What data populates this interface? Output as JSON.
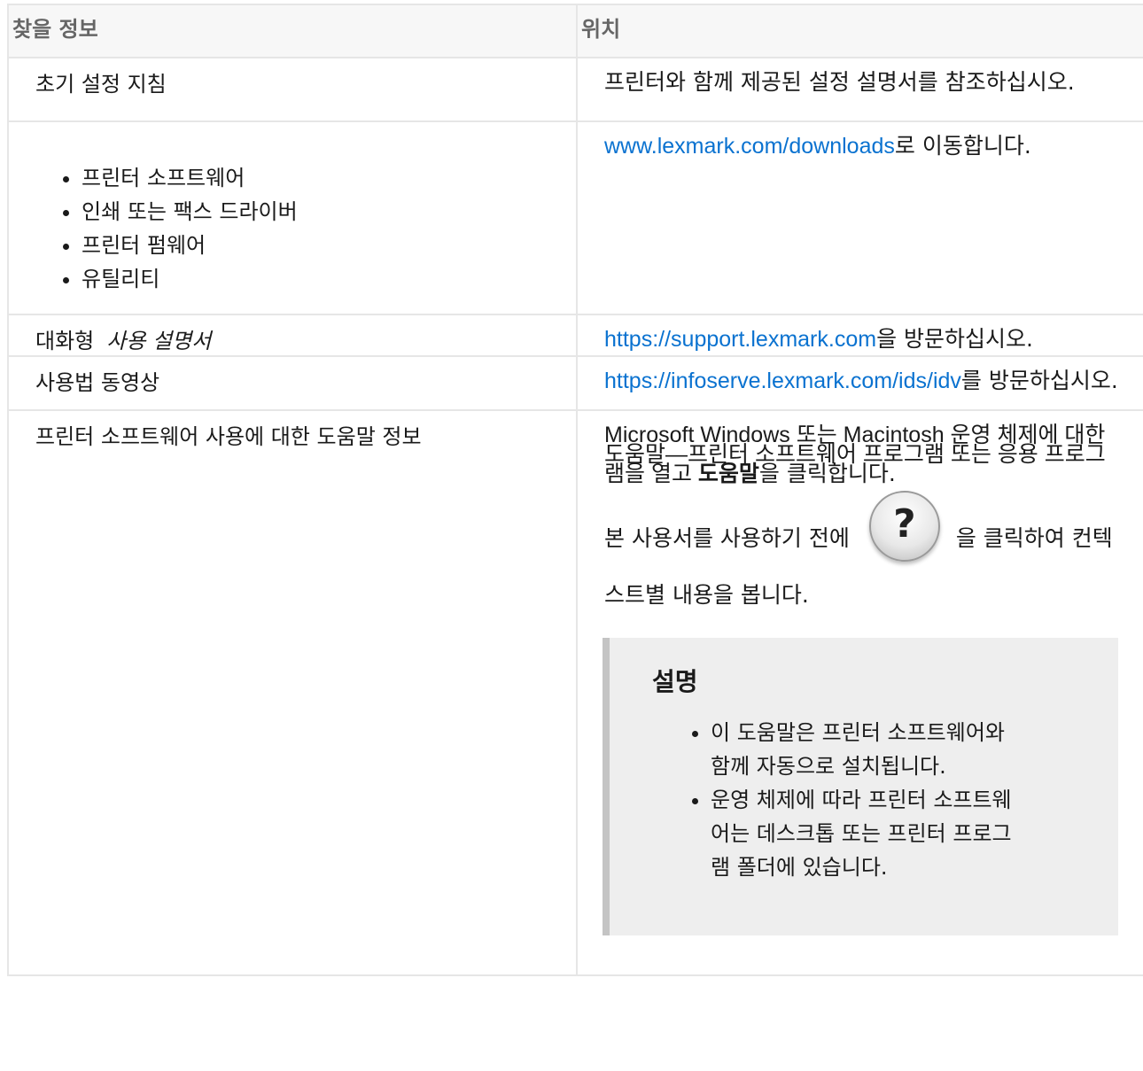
{
  "table": {
    "headers": {
      "info": "찾을 정보",
      "location": "위치"
    },
    "rows": [
      {
        "info": "초기 설정 지침",
        "location": "프린터와 함께 제공된 설정 설명서를 참조하십시오."
      },
      {
        "info_items": [
          "프린터 소프트웨어",
          "인쇄 또는 팩스 드라이버",
          "프린터 펌웨어",
          "유틸리티"
        ],
        "location_link": "www.lexmark.com/downloads",
        "location_suffix": "로 이동합니다."
      },
      {
        "info_prefix": "대화형",
        "info_emphasis": "사용 설명서",
        "location_link": "https://support.lexmark.com",
        "location_suffix": "을 방문하십시오."
      },
      {
        "info": "사용법 동영상",
        "location_link": "https://infoserve.lexmark.com/ids/idv",
        "location_suffix": "를 방문하십시오."
      },
      {
        "info": "프린터 소프트웨어 사용에 대한 도움말 정보",
        "location_text": "Microsoft Windows 또는 Macintosh 운영 체제에 대한 도움말—프린터 소프트웨어 프로그램 또는 응용 프로그램을 열고 ",
        "location_bold": "도움말",
        "location_text_end": "을 클릭합니다.",
        "help_before": "본 사용서를 사용하기 전에",
        "help_icon": "question-mark-icon",
        "help_icon_glyph": "?",
        "help_after": "을 클릭하여 컨텍스트별 내용을 봅니다.",
        "note": {
          "title": "설명",
          "items": [
            "이 도움말은 프린터 소프트웨어와 함께 자동으로 설치됩니다.",
            "운영 체제에 따라 프린터 소프트웨어는 데스크톱 또는 프린터 프로그램 폴더에 있습니다."
          ]
        }
      }
    ]
  },
  "colors": {
    "link": "#0a72d0",
    "header_bg": "#f7f7f7",
    "border": "#e6e6e6",
    "note_bg": "#eeeeee",
    "note_bar": "#c4c4c4"
  }
}
